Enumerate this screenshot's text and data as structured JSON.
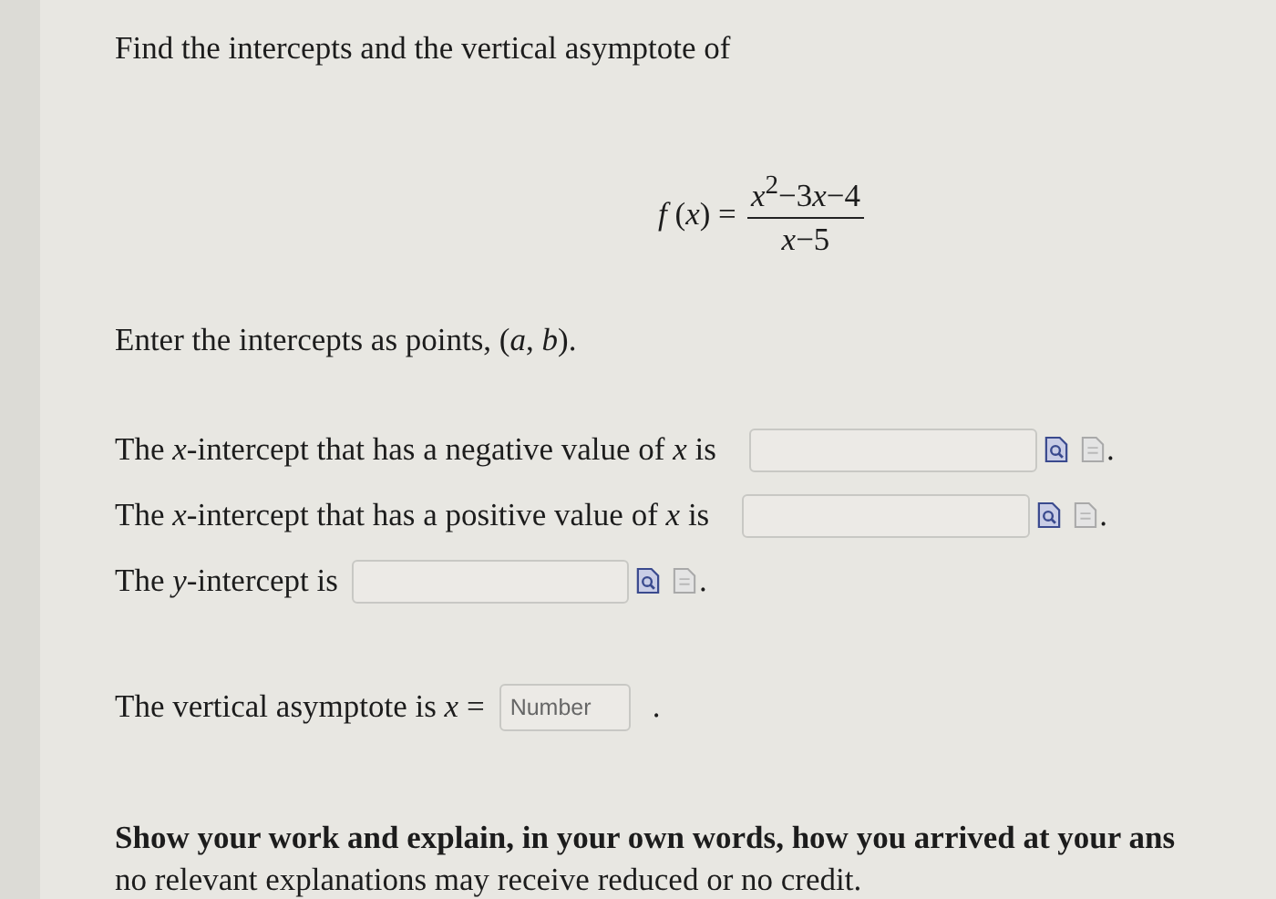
{
  "question": {
    "prompt": "Find the intercepts and the vertical asymptote of",
    "formula": {
      "lhs": "*f* (*x*) =",
      "numerator": [
        {
          "kind": "var",
          "text": "x"
        },
        {
          "kind": "sup",
          "text": "2"
        },
        {
          "kind": "plain",
          "text": "−3"
        },
        {
          "kind": "var",
          "text": "x"
        },
        {
          "kind": "plain",
          "text": "−4"
        }
      ],
      "denominator": "*x*−5"
    },
    "instruction": "Enter the intercepts as points, (*a*, *b*)."
  },
  "answers": [
    {
      "label": "The *x*-intercept that has a negative value of *x* is",
      "end": "."
    },
    {
      "label": "The *x*-intercept that has a positive value of *x* is",
      "end": "."
    },
    {
      "label": "The *y*-intercept is",
      "end": "."
    }
  ],
  "asymptote": {
    "label": "The vertical asymptote is *x* =",
    "placeholder": "Number",
    "end": "."
  },
  "note": {
    "bold_line": "Show your work and explain, in your own words, how you arrived at your ans",
    "line": "no relevant explanations may receive reduced or no credit."
  }
}
